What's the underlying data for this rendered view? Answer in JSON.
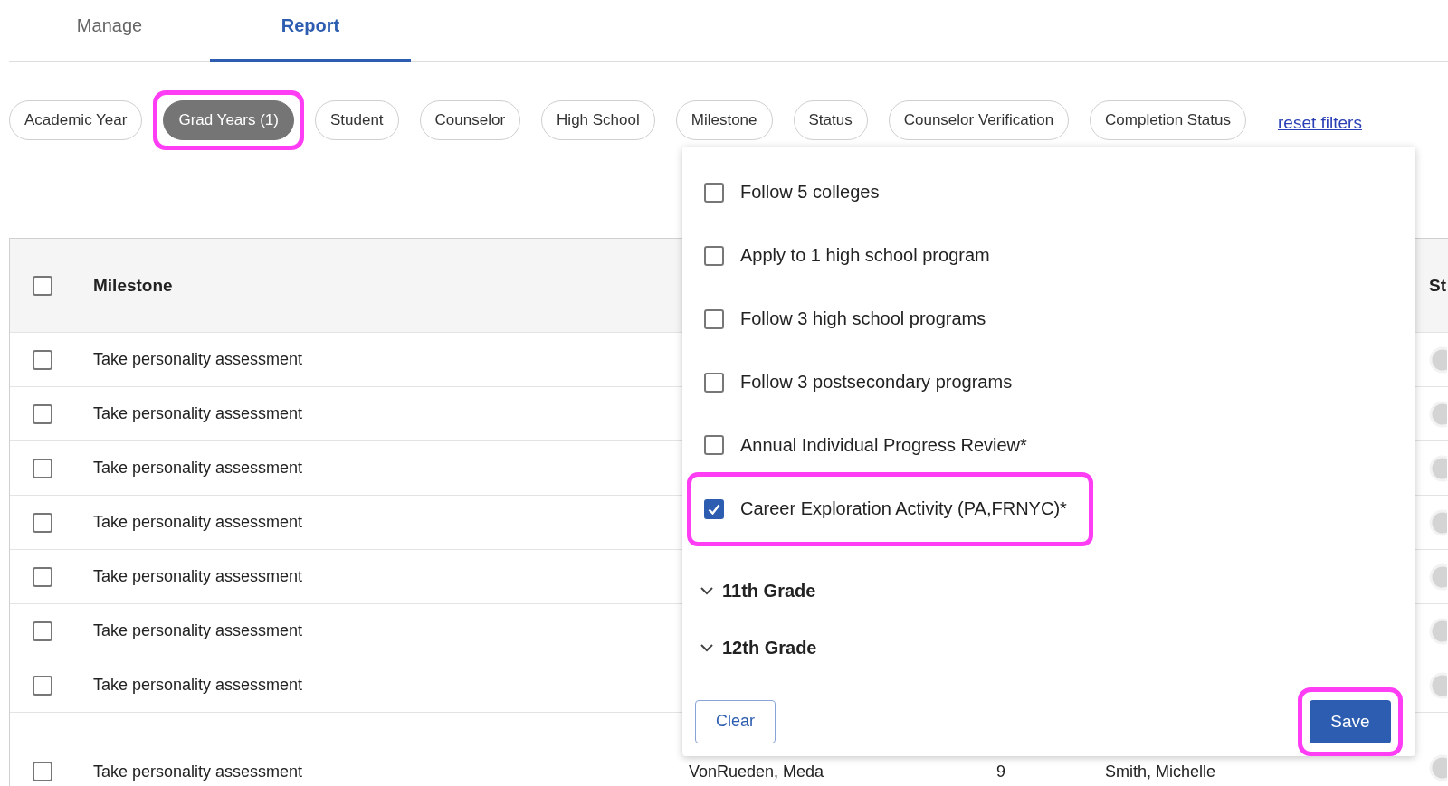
{
  "tabs": [
    {
      "label": "Manage",
      "selected": false
    },
    {
      "label": "Report",
      "selected": true
    }
  ],
  "filters": [
    {
      "label": "Academic Year",
      "selected": false,
      "highlighted": false
    },
    {
      "label": "Grad Years (1)",
      "selected": true,
      "highlighted": true
    },
    {
      "label": "Student",
      "selected": false,
      "highlighted": false
    },
    {
      "label": "Counselor",
      "selected": false,
      "highlighted": false
    },
    {
      "label": "High School",
      "selected": false,
      "highlighted": false
    },
    {
      "label": "Milestone",
      "selected": false,
      "highlighted": false
    },
    {
      "label": "Status",
      "selected": false,
      "highlighted": false
    },
    {
      "label": "Counselor Verification",
      "selected": false,
      "highlighted": false
    },
    {
      "label": "Completion Status",
      "selected": false,
      "highlighted": false
    }
  ],
  "reset_link": "reset filters",
  "table": {
    "header_checked": false,
    "columns": [
      "Milestone",
      "St"
    ],
    "rows": [
      {
        "checked": false,
        "milestone": "Take personality assessment"
      },
      {
        "checked": false,
        "milestone": "Take personality assessment"
      },
      {
        "checked": false,
        "milestone": "Take personality assessment"
      },
      {
        "checked": false,
        "milestone": "Take personality assessment"
      },
      {
        "checked": false,
        "milestone": "Take personality assessment"
      },
      {
        "checked": false,
        "milestone": "Take personality assessment"
      },
      {
        "checked": false,
        "milestone": "Take personality assessment"
      },
      {
        "checked": false,
        "milestone": "Take personality assessment",
        "student": "VonRueden, Meda",
        "grade": "9",
        "counselor": "Smith, Michelle"
      }
    ]
  },
  "dropdown": {
    "options": [
      {
        "label": "Follow 5 colleges",
        "checked": false,
        "highlighted": false
      },
      {
        "label": "Apply to 1 high school program",
        "checked": false,
        "highlighted": false
      },
      {
        "label": "Follow 3 high school programs",
        "checked": false,
        "highlighted": false
      },
      {
        "label": "Follow 3 postsecondary programs",
        "checked": false,
        "highlighted": false
      },
      {
        "label": "Annual Individual Progress Review*",
        "checked": false,
        "highlighted": false
      },
      {
        "label": "Career Exploration Activity (PA,FRNYC)*",
        "checked": true,
        "highlighted": true
      }
    ],
    "groups": [
      {
        "label": "11th Grade",
        "expanded": false
      },
      {
        "label": "12th Grade",
        "expanded": false
      }
    ],
    "clear_button": "Clear",
    "save_button": {
      "label": "Save",
      "highlighted": true
    }
  }
}
